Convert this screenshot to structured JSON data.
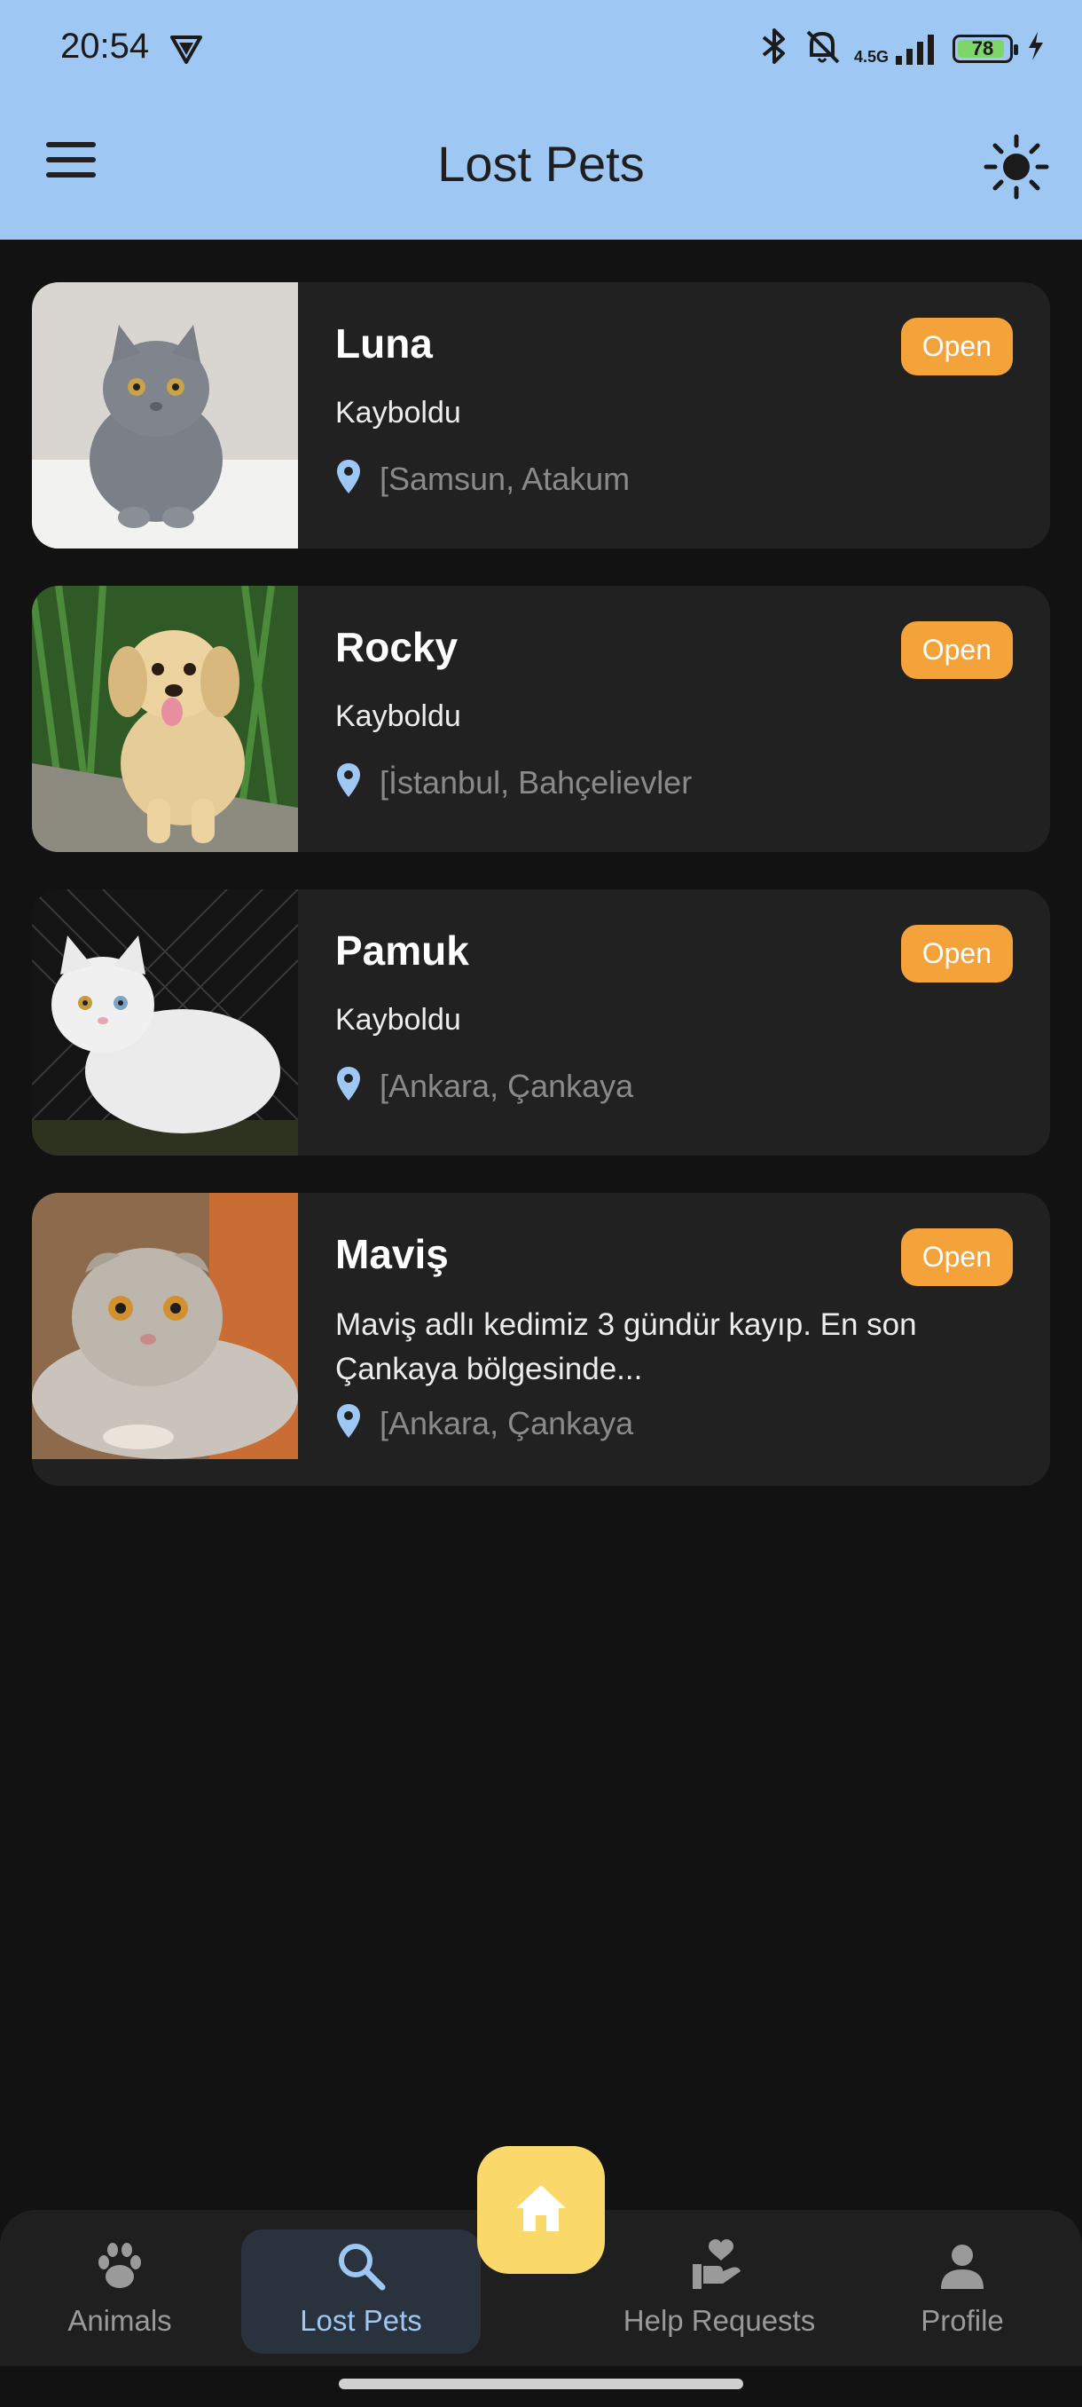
{
  "status_bar": {
    "time": "20:54",
    "network": "4.5G",
    "battery": "78",
    "icons": [
      "vpn-icon",
      "bluetooth-icon",
      "mute-icon",
      "signal-icon",
      "battery-icon",
      "charging-icon"
    ]
  },
  "app_bar": {
    "title": "Lost Pets",
    "menu_icon": "menu-icon",
    "theme_icon": "sun-icon"
  },
  "colors": {
    "app_bar_bg": "#9fc7f3",
    "background": "#121212",
    "card_bg": "#212121",
    "badge_bg": "#f4a23a",
    "accent": "#9fc7f3",
    "fab_bg": "#fbd86a"
  },
  "pets": [
    {
      "name": "Luna",
      "status_label": "Open",
      "description": "Kayboldu",
      "location": "[Samsun, Atakum",
      "image": "gray-kitten-photo"
    },
    {
      "name": "Rocky",
      "status_label": "Open",
      "description": "Kayboldu",
      "location": "[İstanbul, Bahçelievler",
      "image": "golden-puppy-photo"
    },
    {
      "name": "Pamuk",
      "status_label": "Open",
      "description": "Kayboldu",
      "location": "[Ankara, Çankaya",
      "image": "white-cat-photo"
    },
    {
      "name": "Maviş",
      "status_label": "Open",
      "description": "Maviş adlı kedimiz 3 gündür kayıp. En son Çankaya bölgesinde...",
      "location": "[Ankara, Çankaya",
      "image": "scottish-fold-cat-photo"
    }
  ],
  "bottom_nav": {
    "items": [
      {
        "label": "Animals",
        "icon": "paw-icon",
        "active": false
      },
      {
        "label": "Lost Pets",
        "icon": "search-icon",
        "active": true
      },
      {
        "label": "Help Requests",
        "icon": "helping-hand-heart-icon",
        "active": false
      },
      {
        "label": "Profile",
        "icon": "person-icon",
        "active": false
      }
    ],
    "fab_icon": "home-icon"
  }
}
